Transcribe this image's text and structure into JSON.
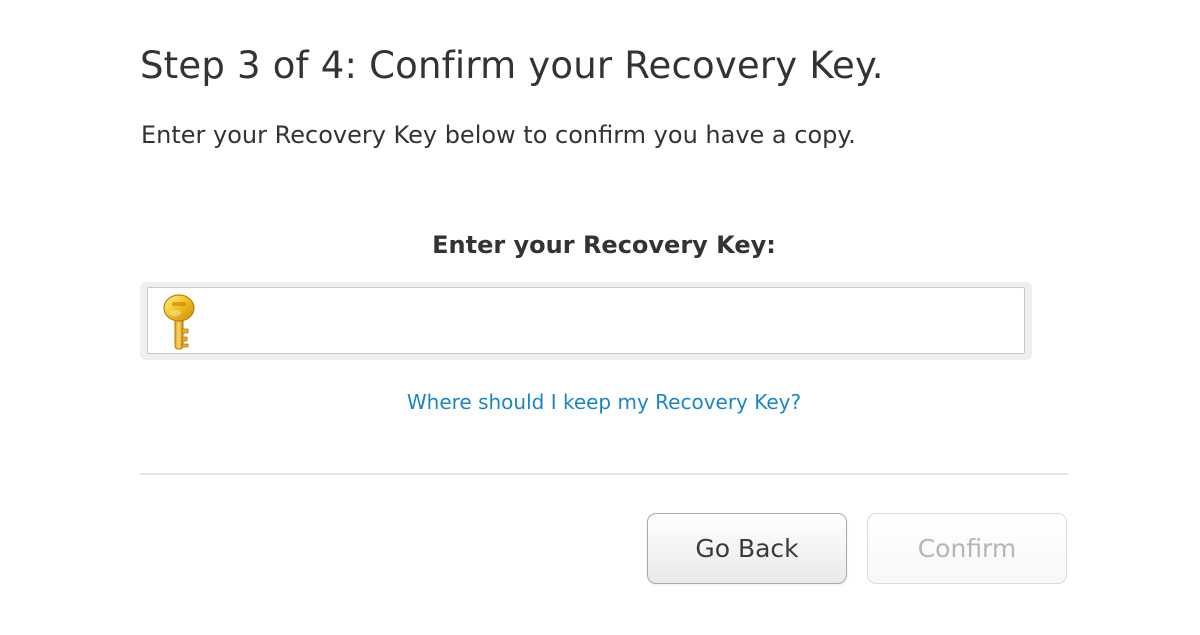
{
  "header": {
    "title": "Step 3 of 4: Confirm your Recovery Key.",
    "description": "Enter your Recovery Key below to confirm you have a copy."
  },
  "form": {
    "label": "Enter your Recovery Key:",
    "input_value": "",
    "input_icon": "key-icon",
    "help_link": "Where should I keep my Recovery Key?"
  },
  "actions": {
    "back_label": "Go Back",
    "confirm_label": "Confirm",
    "confirm_enabled": false
  },
  "colors": {
    "text": "#333333",
    "link": "#1a86c5",
    "disabled_text": "#b5b5b5",
    "key_gold": "#f2c21d"
  }
}
